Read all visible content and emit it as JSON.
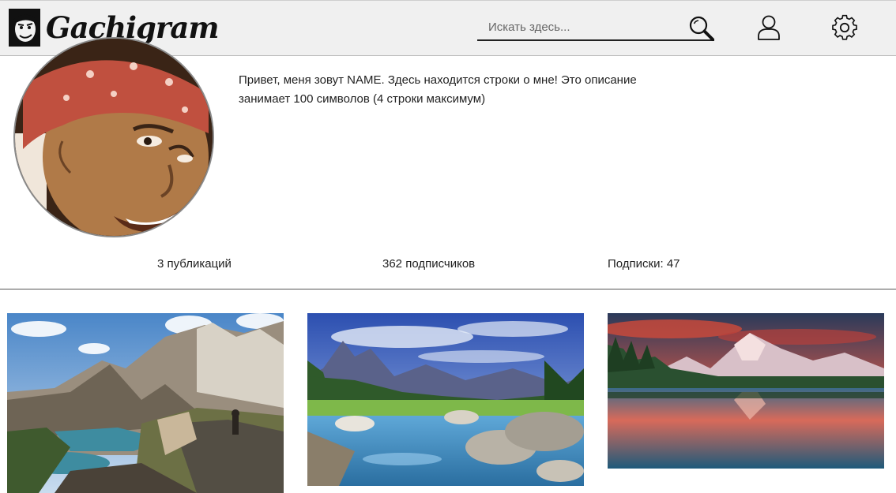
{
  "header": {
    "logo_text": "Gachigram",
    "search": {
      "placeholder": "Искать здесь...",
      "value": ""
    },
    "icons": [
      "search-icon",
      "user-icon",
      "gear-icon"
    ]
  },
  "profile": {
    "bio": "Привет, меня зовут NAME. Здесь находится строки о мне! Это описание занимает 100 символов (4 строки максимум)",
    "stats": {
      "posts": "3 публикаций",
      "followers": "362 подписчиков",
      "following": "Подписки: 47"
    }
  },
  "gallery": {
    "photos": [
      {
        "subject": "mountain-lake-hiker"
      },
      {
        "subject": "alpine-stream-rocks"
      },
      {
        "subject": "sunset-mountain-reflection"
      }
    ]
  },
  "colors": {
    "header_bg": "#f0f0f0",
    "text": "#222222",
    "divider": "#555555"
  }
}
